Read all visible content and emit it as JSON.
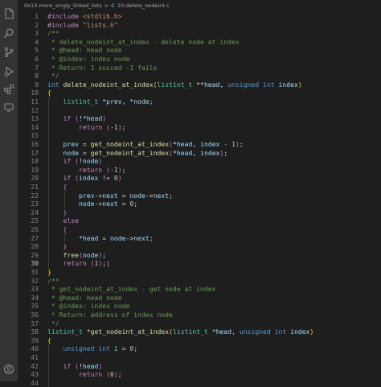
{
  "breadcrumb": {
    "folder": "0x13-more_singly_linked_lists",
    "separator": ">",
    "file_icon": "C",
    "file": "10-delete_nodeint.c"
  },
  "activity_bar": {
    "icons": [
      "files-icon",
      "search-icon",
      "source-control-icon",
      "run-debug-icon",
      "extensions-icon",
      "remote-explorer-icon",
      "account-icon"
    ]
  },
  "editor": {
    "active_line": 30,
    "lines": [
      {
        "n": "1",
        "t": [
          [
            "pp",
            "#include "
          ],
          [
            "str",
            "<stdlib.h>"
          ]
        ]
      },
      {
        "n": "2",
        "t": [
          [
            "pp",
            "#include "
          ],
          [
            "str",
            "\"lists.h\""
          ]
        ]
      },
      {
        "n": "3",
        "t": [
          [
            "cm",
            "/**"
          ]
        ]
      },
      {
        "n": "4",
        "t": [
          [
            "cm",
            " * delete_nodeint_at_index - delete node at index"
          ]
        ]
      },
      {
        "n": "5",
        "t": [
          [
            "cm",
            " * @head: head node"
          ]
        ]
      },
      {
        "n": "6",
        "t": [
          [
            "cm",
            " * @index: index node"
          ]
        ]
      },
      {
        "n": "7",
        "t": [
          [
            "cm",
            " * Return: 1 succed -1 fails"
          ]
        ]
      },
      {
        "n": "8",
        "t": [
          [
            "cm",
            " */"
          ]
        ]
      },
      {
        "n": "9",
        "t": [
          [
            "kw",
            "int "
          ],
          [
            "fn",
            "delete_nodeint_at_index"
          ],
          [
            "br1",
            "("
          ],
          [
            "ty",
            "listint_t "
          ],
          [
            "pl",
            "**"
          ],
          [
            "var",
            "head"
          ],
          [
            "pl",
            ", "
          ],
          [
            "kw",
            "unsigned int "
          ],
          [
            "var",
            "index"
          ],
          [
            "br1",
            ")"
          ]
        ]
      },
      {
        "n": "10",
        "t": [
          [
            "br1",
            "{"
          ]
        ]
      },
      {
        "n": "11",
        "t": [
          [
            "ty",
            "    listint_t "
          ],
          [
            "pl",
            "*"
          ],
          [
            "var",
            "prev"
          ],
          [
            "pl",
            ", *"
          ],
          [
            "var",
            "node"
          ],
          [
            "pl",
            ";"
          ]
        ]
      },
      {
        "n": "12",
        "t": []
      },
      {
        "n": "13",
        "t": [
          [
            "ctl",
            "    if "
          ],
          [
            "br2",
            "("
          ],
          [
            "pl",
            "!*"
          ],
          [
            "var",
            "head"
          ],
          [
            "br2",
            ")"
          ]
        ]
      },
      {
        "n": "14",
        "t": [
          [
            "ctl",
            "        return "
          ],
          [
            "br2",
            "("
          ],
          [
            "pl",
            "-"
          ],
          [
            "num",
            "1"
          ],
          [
            "br2",
            ")"
          ],
          [
            "pl",
            ";"
          ]
        ]
      },
      {
        "n": "15",
        "t": []
      },
      {
        "n": "16",
        "t": [
          [
            "var",
            "    prev"
          ],
          [
            "pl",
            " = "
          ],
          [
            "fn",
            "get_nodeint_at_index"
          ],
          [
            "br2",
            "("
          ],
          [
            "pl",
            "*"
          ],
          [
            "var",
            "head"
          ],
          [
            "pl",
            ", "
          ],
          [
            "var",
            "index"
          ],
          [
            "pl",
            " - "
          ],
          [
            "num",
            "1"
          ],
          [
            "br2",
            ")"
          ],
          [
            "pl",
            ";"
          ]
        ]
      },
      {
        "n": "17",
        "t": [
          [
            "var",
            "    node"
          ],
          [
            "pl",
            " = "
          ],
          [
            "fn",
            "get_nodeint_at_index"
          ],
          [
            "br2",
            "("
          ],
          [
            "pl",
            "*"
          ],
          [
            "var",
            "head"
          ],
          [
            "pl",
            ", "
          ],
          [
            "var",
            "index"
          ],
          [
            "br2",
            ")"
          ],
          [
            "pl",
            ";"
          ]
        ]
      },
      {
        "n": "18",
        "t": [
          [
            "ctl",
            "    if "
          ],
          [
            "br2",
            "("
          ],
          [
            "pl",
            "!"
          ],
          [
            "var",
            "node"
          ],
          [
            "br2",
            ")"
          ]
        ]
      },
      {
        "n": "19",
        "t": [
          [
            "ctl",
            "        return "
          ],
          [
            "br2",
            "("
          ],
          [
            "pl",
            "-"
          ],
          [
            "num",
            "1"
          ],
          [
            "br2",
            ")"
          ],
          [
            "pl",
            ";"
          ]
        ]
      },
      {
        "n": "20",
        "t": [
          [
            "ctl",
            "    if "
          ],
          [
            "br2",
            "("
          ],
          [
            "var",
            "index"
          ],
          [
            "pl",
            " != "
          ],
          [
            "num",
            "0"
          ],
          [
            "br2",
            ")"
          ]
        ]
      },
      {
        "n": "21",
        "t": [
          [
            "br2",
            "    {"
          ]
        ]
      },
      {
        "n": "22",
        "t": [
          [
            "var",
            "        prev"
          ],
          [
            "pl",
            "->"
          ],
          [
            "var",
            "next"
          ],
          [
            "pl",
            " = "
          ],
          [
            "var",
            "node"
          ],
          [
            "pl",
            "->"
          ],
          [
            "var",
            "next"
          ],
          [
            "pl",
            ";"
          ]
        ]
      },
      {
        "n": "23",
        "t": [
          [
            "var",
            "        node"
          ],
          [
            "pl",
            "->"
          ],
          [
            "var",
            "next"
          ],
          [
            "pl",
            " = "
          ],
          [
            "num",
            "0"
          ],
          [
            "pl",
            ";"
          ]
        ]
      },
      {
        "n": "24",
        "t": [
          [
            "br2",
            "    }"
          ]
        ]
      },
      {
        "n": "25",
        "t": [
          [
            "ctl",
            "    else"
          ]
        ]
      },
      {
        "n": "26",
        "t": [
          [
            "br2",
            "    {"
          ]
        ]
      },
      {
        "n": "27",
        "t": [
          [
            "pl",
            "        *"
          ],
          [
            "var",
            "head"
          ],
          [
            "pl",
            " = "
          ],
          [
            "var",
            "node"
          ],
          [
            "pl",
            "->"
          ],
          [
            "var",
            "next"
          ],
          [
            "pl",
            ";"
          ]
        ]
      },
      {
        "n": "28",
        "t": [
          [
            "br2",
            "    }"
          ]
        ]
      },
      {
        "n": "29",
        "t": [
          [
            "fn",
            "    free"
          ],
          [
            "br2",
            "("
          ],
          [
            "var",
            "node"
          ],
          [
            "br2",
            ")"
          ],
          [
            "pl",
            ";"
          ]
        ]
      },
      {
        "n": "30",
        "t": [
          [
            "ctl",
            "    return "
          ],
          [
            "br2",
            "("
          ],
          [
            "num",
            "1"
          ],
          [
            "br2",
            ")"
          ],
          [
            "pl",
            ";"
          ]
        ]
      },
      {
        "n": "31",
        "t": [
          [
            "br1",
            "}"
          ]
        ]
      },
      {
        "n": "32",
        "t": [
          [
            "cm",
            "/**"
          ]
        ]
      },
      {
        "n": "33",
        "t": [
          [
            "cm",
            " * get_nodeint_at_index - get node at index"
          ]
        ]
      },
      {
        "n": "34",
        "t": [
          [
            "cm",
            " * @head: head node"
          ]
        ]
      },
      {
        "n": "35",
        "t": [
          [
            "cm",
            " * @index: index node"
          ]
        ]
      },
      {
        "n": "36",
        "t": [
          [
            "cm",
            " * Return: address of index node"
          ]
        ]
      },
      {
        "n": "37",
        "t": [
          [
            "cm",
            " */"
          ]
        ]
      },
      {
        "n": "38",
        "t": [
          [
            "ty",
            "listint_t "
          ],
          [
            "pl",
            "*"
          ],
          [
            "fn",
            "get_nodeint_at_index"
          ],
          [
            "br1",
            "("
          ],
          [
            "ty",
            "listint_t "
          ],
          [
            "pl",
            "*"
          ],
          [
            "var",
            "head"
          ],
          [
            "pl",
            ", "
          ],
          [
            "kw",
            "unsigned int "
          ],
          [
            "var",
            "index"
          ],
          [
            "br1",
            ")"
          ]
        ]
      },
      {
        "n": "39",
        "t": [
          [
            "br1",
            "{"
          ]
        ]
      },
      {
        "n": "40",
        "t": [
          [
            "kw",
            "    unsigned int "
          ],
          [
            "var",
            "i"
          ],
          [
            "pl",
            " = "
          ],
          [
            "num",
            "0"
          ],
          [
            "pl",
            ";"
          ]
        ]
      },
      {
        "n": "41",
        "t": []
      },
      {
        "n": "42",
        "t": [
          [
            "ctl",
            "    if "
          ],
          [
            "br2",
            "("
          ],
          [
            "pl",
            "!"
          ],
          [
            "var",
            "head"
          ],
          [
            "br2",
            ")"
          ]
        ]
      },
      {
        "n": "43",
        "t": [
          [
            "ctl",
            "        return "
          ],
          [
            "br2",
            "("
          ],
          [
            "num",
            "0"
          ],
          [
            "br2",
            ")"
          ],
          [
            "pl",
            ";"
          ]
        ]
      },
      {
        "n": "44",
        "t": []
      }
    ]
  }
}
